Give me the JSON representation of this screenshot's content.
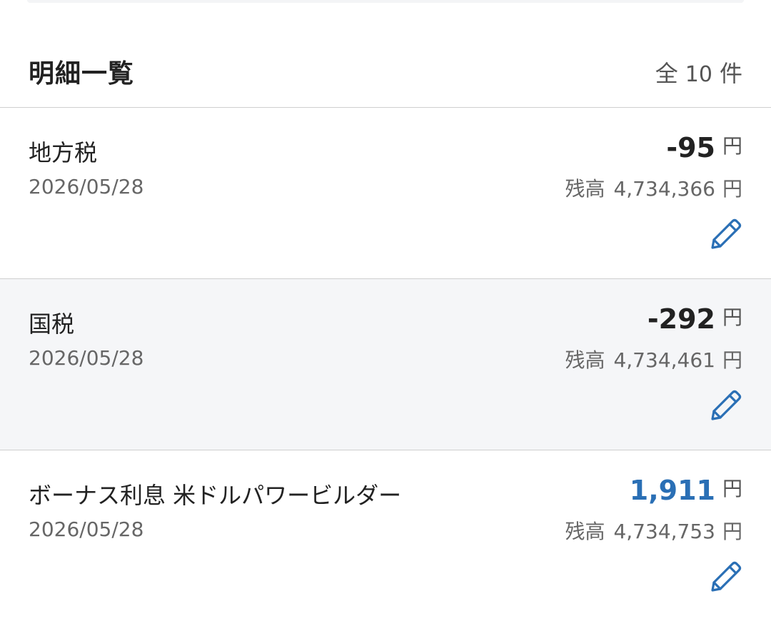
{
  "header": {
    "title": "明細一覧",
    "count_prefix": "全",
    "count_value": "10",
    "count_suffix": "件"
  },
  "currency_unit": "円",
  "balance_label": "残高",
  "colors": {
    "income": "#2a6fb5",
    "expense": "#222222",
    "edit_icon": "#2a6fb5",
    "highlight_row": "#f5f6f8"
  },
  "transactions": [
    {
      "name": "地方税",
      "date": "2026/05/28",
      "amount": "-95",
      "type": "expense",
      "balance": "4,734,366",
      "icon": "pencil-icon"
    },
    {
      "name": "国税",
      "date": "2026/05/28",
      "amount": "-292",
      "type": "expense",
      "balance": "4,734,461",
      "icon": "pencil-icon",
      "highlighted": true
    },
    {
      "name": "ボーナス利息 米ドルパワービルダー",
      "date": "2026/05/28",
      "amount": "1,911",
      "type": "income",
      "balance": "4,734,753",
      "icon": "pencil-icon"
    }
  ]
}
